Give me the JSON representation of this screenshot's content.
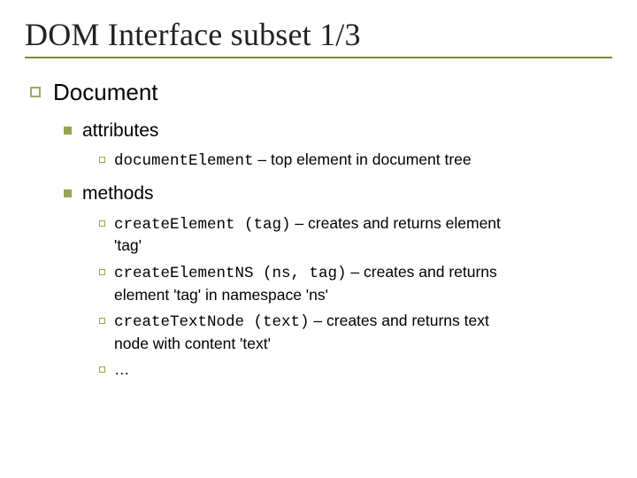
{
  "title": "DOM Interface subset 1/3",
  "level1": {
    "label": "Document"
  },
  "level2": {
    "attributes": {
      "label": "attributes"
    },
    "methods": {
      "label": "methods"
    }
  },
  "attr_items": [
    {
      "code": "documentElement",
      "desc": " – top element in document tree"
    }
  ],
  "method_items": [
    {
      "code": "createElement (tag)",
      "desc_a": " – creates and returns element",
      "desc_b": "'tag'"
    },
    {
      "code": "createElementNS (ns, tag)",
      "desc_a": " – creates and returns",
      "desc_b": "element 'tag' in namespace 'ns'"
    },
    {
      "code": "createTextNode (text)",
      "desc_a": " – creates and returns text",
      "desc_b": "node with content 'text'"
    },
    {
      "ellipsis": "…"
    }
  ]
}
